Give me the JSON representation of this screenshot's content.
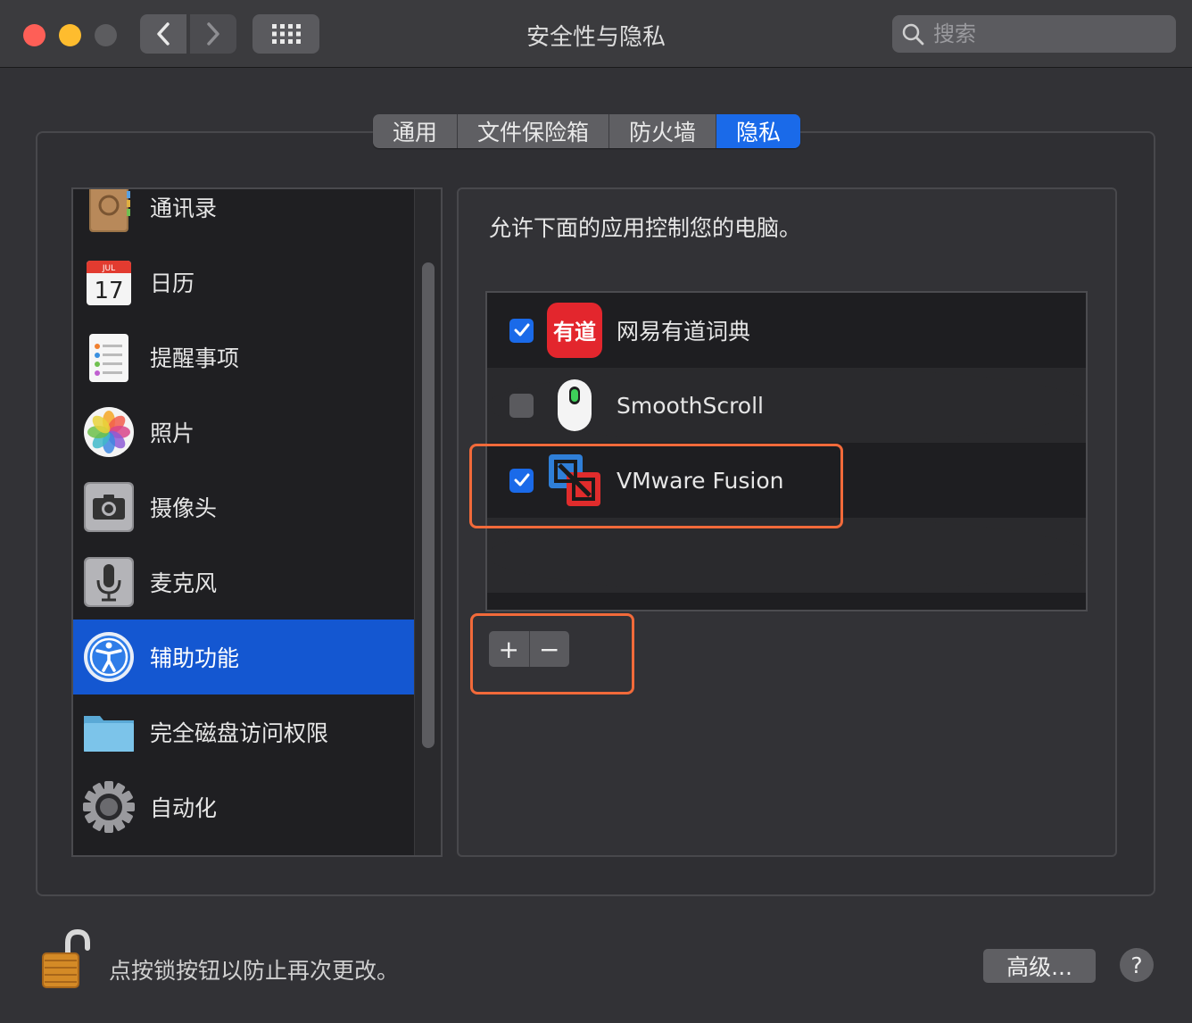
{
  "window": {
    "title": "安全性与隐私",
    "search_placeholder": "搜索"
  },
  "tabs": [
    {
      "label": "通用",
      "active": false
    },
    {
      "label": "文件保险箱",
      "active": false
    },
    {
      "label": "防火墙",
      "active": false
    },
    {
      "label": "隐私",
      "active": true
    }
  ],
  "sidebar": {
    "items": [
      {
        "label": "通讯录",
        "icon": "contacts-icon"
      },
      {
        "label": "日历",
        "icon": "calendar-icon",
        "icon_month": "JUL",
        "icon_day": "17"
      },
      {
        "label": "提醒事项",
        "icon": "reminders-icon"
      },
      {
        "label": "照片",
        "icon": "photos-icon"
      },
      {
        "label": "摄像头",
        "icon": "camera-icon"
      },
      {
        "label": "麦克风",
        "icon": "microphone-icon"
      },
      {
        "label": "辅助功能",
        "icon": "accessibility-icon",
        "selected": true
      },
      {
        "label": "完全磁盘访问权限",
        "icon": "folder-icon"
      },
      {
        "label": "自动化",
        "icon": "gear-icon"
      }
    ]
  },
  "main": {
    "prompt": "允许下面的应用控制您的电脑。",
    "apps": [
      {
        "name": "网易有道词典",
        "checked": true,
        "icon": "youdao-icon",
        "icon_text": "有道"
      },
      {
        "name": "SmoothScroll",
        "checked": false,
        "icon": "mouse-icon"
      },
      {
        "name": "VMware Fusion",
        "checked": true,
        "icon": "vmware-icon"
      }
    ],
    "add_label": "+",
    "remove_label": "−"
  },
  "footer": {
    "lock_text": "点按锁按钮以防止再次更改。",
    "advanced_label": "高级...",
    "help_label": "?"
  },
  "colors": {
    "accent": "#1a6ae9",
    "selection": "#1457d1",
    "highlight_box": "#f26a3a"
  }
}
